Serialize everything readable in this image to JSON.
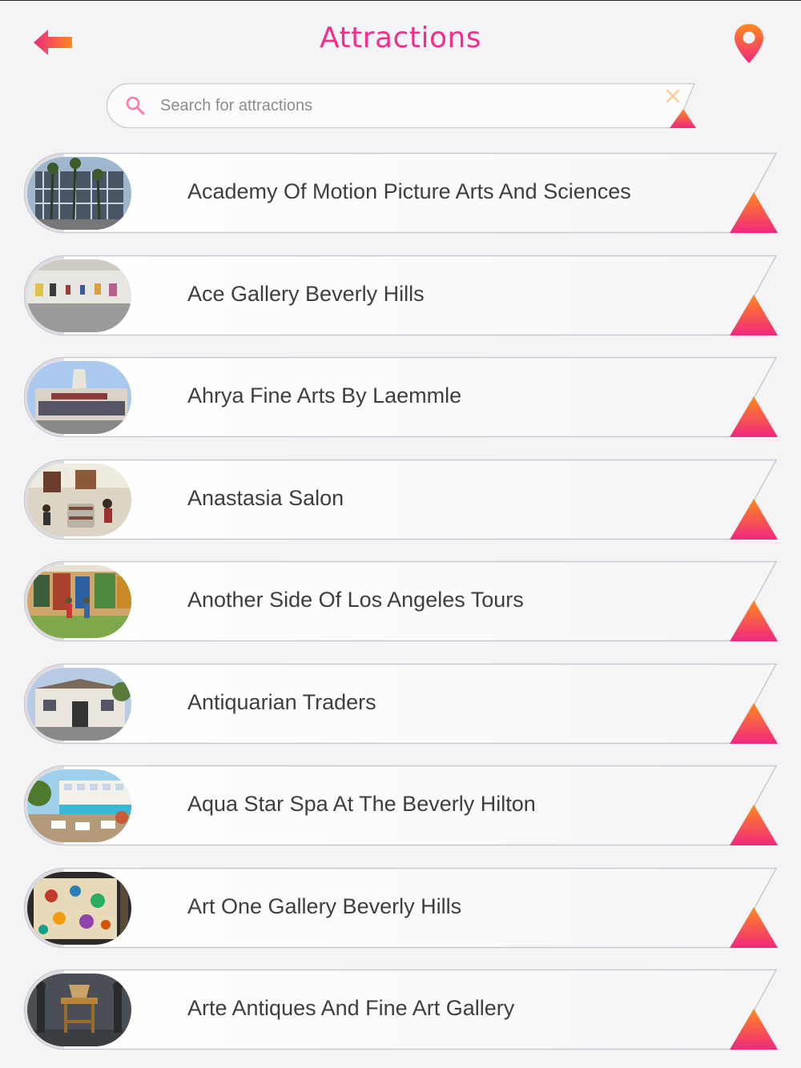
{
  "header": {
    "title": "Attractions",
    "back_icon": "arrow-left-icon",
    "map_icon": "map-pin-icon"
  },
  "search": {
    "placeholder": "Search for attractions",
    "value": "",
    "search_icon": "search-icon",
    "clear_icon": "close-icon"
  },
  "colors": {
    "accent": "#f0308a",
    "accent_orange": "#ff8a1c",
    "background": "#f4f4f6",
    "text": "#3e3e3e"
  },
  "attractions": [
    {
      "name": "Academy Of Motion Picture Arts And Sciences",
      "image": "building-with-palm-trees"
    },
    {
      "name": "Ace Gallery Beverly Hills",
      "image": "gallery-interior"
    },
    {
      "name": "Ahrya Fine Arts By Laemmle",
      "image": "theater-facade"
    },
    {
      "name": "Anastasia Salon",
      "image": "salon-interior"
    },
    {
      "name": "Another Side Of Los Angeles Tours",
      "image": "mural-with-segways"
    },
    {
      "name": "Antiquarian Traders",
      "image": "storefront"
    },
    {
      "name": "Aqua Star Spa At The Beverly Hilton",
      "image": "pool-terrace"
    },
    {
      "name": "Art One Gallery Beverly Hills",
      "image": "colorful-painting"
    },
    {
      "name": "Arte Antiques And Fine Art Gallery",
      "image": "antique-furniture"
    }
  ]
}
